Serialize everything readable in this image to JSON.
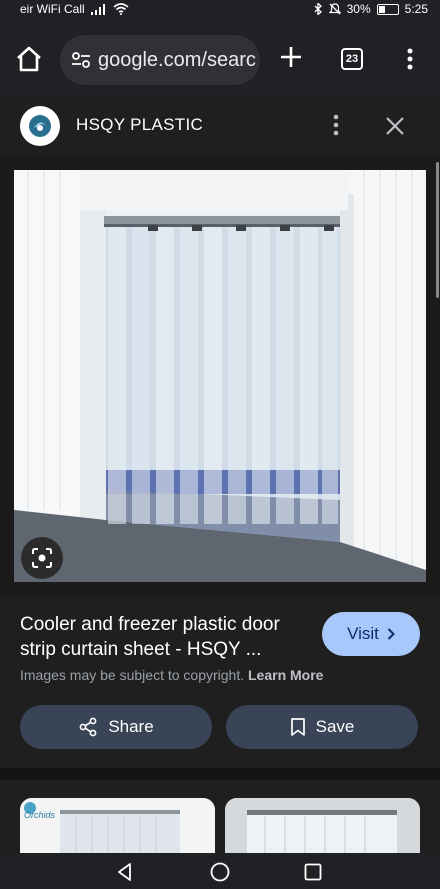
{
  "status_bar": {
    "carrier": "eir WiFi Call",
    "battery": "30%",
    "time": "5:25"
  },
  "browser": {
    "url": "google.com/searc",
    "tab_count": "23"
  },
  "site": {
    "name": "HSQY PLASTIC"
  },
  "result": {
    "title": "Cooler and freezer plastic door strip curtain sheet - HSQY ...",
    "visit_label": "Visit",
    "copyright_text": "Images may be subject to copyright.",
    "learn_more": "Learn More",
    "share_label": "Share",
    "save_label": "Save"
  },
  "related": {
    "thumb1_logo_text": "Orchids"
  },
  "icons": {
    "home": "home-icon",
    "tune": "tune-icon",
    "plus": "plus-icon",
    "menu": "more-vert-icon",
    "close": "close-icon",
    "lens": "lens-icon",
    "share": "share-icon",
    "bookmark": "bookmark-icon",
    "back": "back-triangle-icon",
    "home_nav": "home-circle-icon",
    "recents": "recents-square-icon"
  },
  "colors": {
    "visit_button": "#a8c7fa",
    "action_button": "#394457",
    "background": "#1f1f1f"
  }
}
